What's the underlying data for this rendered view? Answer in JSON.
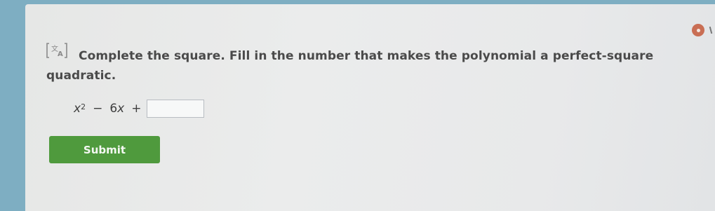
{
  "question": {
    "prompt_line1": "Complete the square. Fill in the number that makes the polynomial a perfect-square",
    "prompt_line2": "quadratic."
  },
  "equation": {
    "term1_var": "x",
    "term1_exp": "2",
    "op1": "−",
    "term2": "6",
    "term2_var": "x",
    "op2": "+",
    "answer_value": ""
  },
  "submit": {
    "label": "Submit"
  },
  "colors": {
    "submit_bg": "#4f9a3d",
    "page_bg": "#7eaec2",
    "panel_bg": "#e8e9e9",
    "corner_icon": "#c96e54"
  },
  "icons": {
    "translate": "translate-icon",
    "corner": "circle-dot-icon"
  }
}
